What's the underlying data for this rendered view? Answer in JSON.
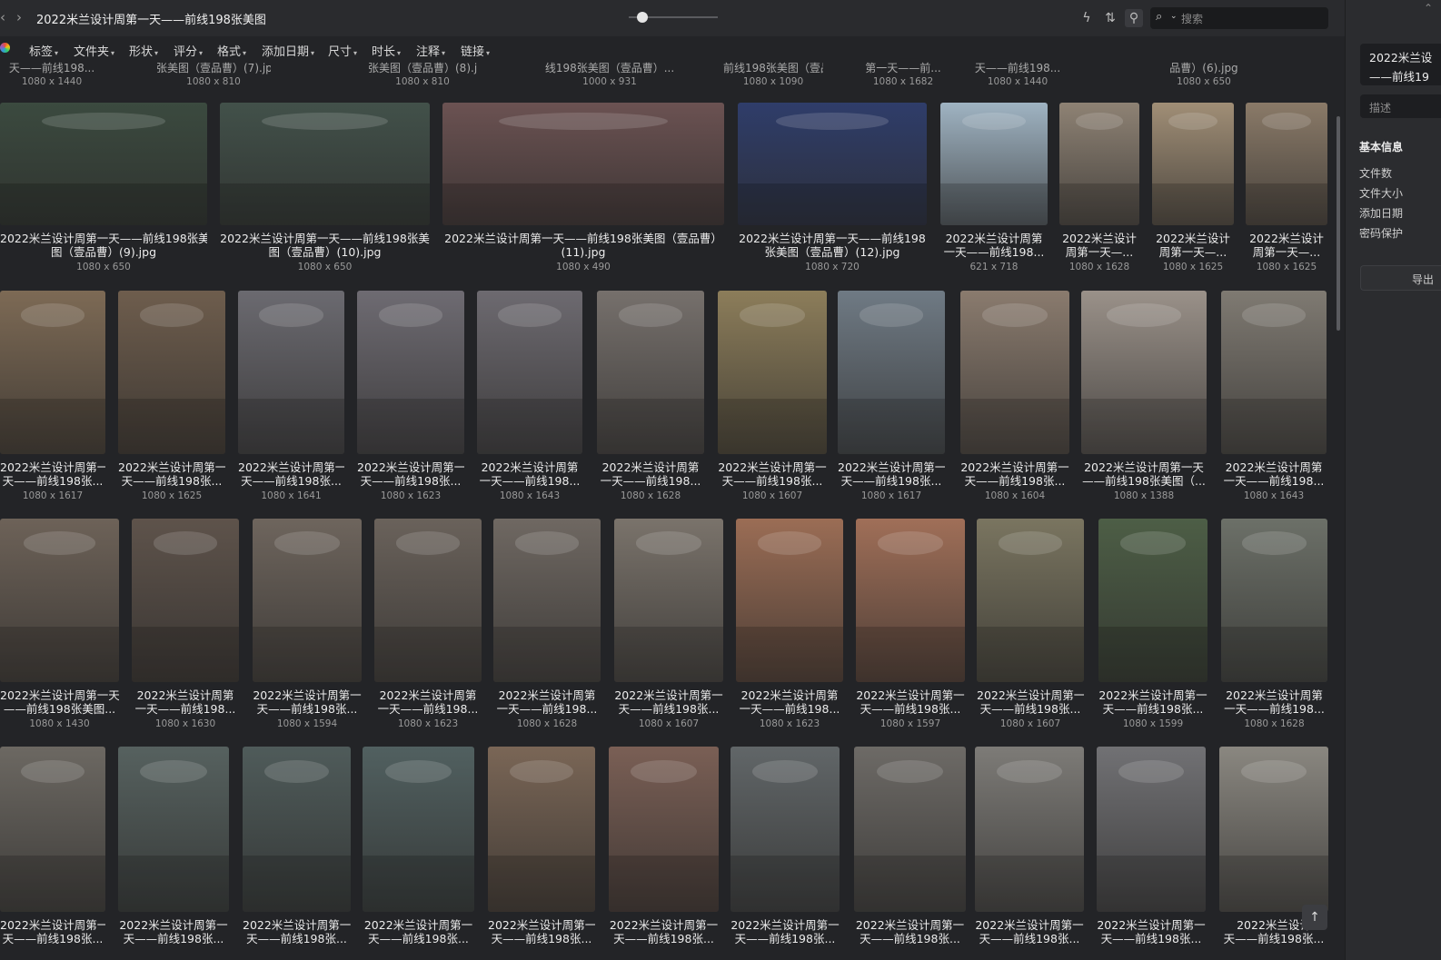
{
  "window": {
    "title": "2022米兰设计周第一天——前线198张美图"
  },
  "toolbar": {
    "back_icon": "‹",
    "forward_icon": "›",
    "search_placeholder": "搜索",
    "icons": {
      "lightning": "ϟ",
      "sort": "⇅",
      "filter": "⚲",
      "search": "⌕",
      "caret": "⌄"
    },
    "zoom_level": 0.1
  },
  "filters": [
    "标签",
    "文件夹",
    "形状",
    "评分",
    "格式",
    "添加日期",
    "尺寸",
    "时长",
    "注释",
    "链接"
  ],
  "previous_row": [
    {
      "name": "天——前线198...",
      "dim": "1080 x 1440"
    },
    {
      "name": "张美图（壹品曹）(7).jpg",
      "dim": "1080 x 810"
    },
    {
      "name": "张美图（壹品曹）(8).jpg",
      "dim": "1080 x 810"
    },
    {
      "name": "线198张美图（壹品曹）...",
      "dim": "1000 x 931"
    },
    {
      "name": "前线198张美图（壹品曹...",
      "dim": "1080 x 1090"
    },
    {
      "name": "第一天——前...",
      "dim": "1080 x 1682"
    },
    {
      "name": "天——前线198...",
      "dim": "1080 x 1440"
    },
    {
      "name": "品曹）(6).jpg",
      "dim": "1080 x 650"
    }
  ],
  "rows": [
    [
      {
        "name1": "2022米兰设计周第一天——前线198张美",
        "name2": "图（壹品曹）(9).jpg",
        "dim": "1080 x 650",
        "color": "#3b4a3f"
      },
      {
        "name1": "2022米兰设计周第一天——前线198张美",
        "name2": "图（壹品曹）(10).jpg",
        "dim": "1080 x 650",
        "color": "#42514a"
      },
      {
        "name1": "2022米兰设计周第一天——前线198张美图（壹品曹）",
        "name2": "(11).jpg",
        "dim": "1080 x 490",
        "color": "#6b5252"
      },
      {
        "name1": "2022米兰设计周第一天——前线198",
        "name2": "张美图（壹品曹）(12).jpg",
        "dim": "1080 x 720",
        "color": "#2f3d6a"
      },
      {
        "name1": "2022米兰设计周第",
        "name2": "一天——前线198...",
        "dim": "621 x 718",
        "color": "#9fb3c2"
      },
      {
        "name1": "2022米兰设计",
        "name2": "周第一天—...",
        "dim": "1080 x 1628",
        "color": "#8e8274"
      },
      {
        "name1": "2022米兰设计",
        "name2": "周第一天—...",
        "dim": "1080 x 1625",
        "color": "#a08e76"
      },
      {
        "name1": "2022米兰设计",
        "name2": "周第一天—...",
        "dim": "1080 x 1625",
        "color": "#8a7a68"
      }
    ],
    [
      {
        "name1": "2022米兰设计周第一",
        "name2": "天——前线198张...",
        "dim": "1080 x 1617",
        "color": "#7d6a55"
      },
      {
        "name1": "2022米兰设计周第一",
        "name2": "天——前线198张...",
        "dim": "1080 x 1625",
        "color": "#6e5d4d"
      },
      {
        "name1": "2022米兰设计周第一",
        "name2": "天——前线198张...",
        "dim": "1080 x 1641",
        "color": "#6b6a70"
      },
      {
        "name1": "2022米兰设计周第一",
        "name2": "天——前线198张...",
        "dim": "1080 x 1623",
        "color": "#6e6b72"
      },
      {
        "name1": "2022米兰设计周第",
        "name2": "一天——前线198...",
        "dim": "1080 x 1643",
        "color": "#6d6a70"
      },
      {
        "name1": "2022米兰设计周第",
        "name2": "一天——前线198...",
        "dim": "1080 x 1628",
        "color": "#76706c"
      },
      {
        "name1": "2022米兰设计周第一",
        "name2": "天——前线198张...",
        "dim": "1080 x 1607",
        "color": "#8c7d5a"
      },
      {
        "name1": "2022米兰设计周第一",
        "name2": "天——前线198张...",
        "dim": "1080 x 1617",
        "color": "#6f7a84"
      },
      {
        "name1": "2022米兰设计周第一",
        "name2": "天——前线198张...",
        "dim": "1080 x 1604",
        "color": "#8a7b6e"
      },
      {
        "name1": "2022米兰设计周第一天",
        "name2": "——前线198张美图（...",
        "dim": "1080 x 1388",
        "color": "#9a9189"
      },
      {
        "name1": "2022米兰设计周第",
        "name2": "一天——前线198...",
        "dim": "1080 x 1643",
        "color": "#7f7a72"
      }
    ],
    [
      {
        "name1": "2022米兰设计周第一天",
        "name2": "——前线198张美图...",
        "dim": "1080 x 1430",
        "color": "#6d6258"
      },
      {
        "name1": "2022米兰设计周第",
        "name2": "一天——前线198...",
        "dim": "1080 x 1630",
        "color": "#5e534b"
      },
      {
        "name1": "2022米兰设计周第一",
        "name2": "天——前线198张...",
        "dim": "1080 x 1594",
        "color": "#6e655d"
      },
      {
        "name1": "2022米兰设计周第",
        "name2": "一天——前线198...",
        "dim": "1080 x 1623",
        "color": "#6a625b"
      },
      {
        "name1": "2022米兰设计周第",
        "name2": "一天——前线198...",
        "dim": "1080 x 1628",
        "color": "#6f6862"
      },
      {
        "name1": "2022米兰设计周第一",
        "name2": "天——前线198张...",
        "dim": "1080 x 1607",
        "color": "#7a736b"
      },
      {
        "name1": "2022米兰设计周第",
        "name2": "一天——前线198...",
        "dim": "1080 x 1623",
        "color": "#9b6d55"
      },
      {
        "name1": "2022米兰设计周第一",
        "name2": "天——前线198张...",
        "dim": "1080 x 1597",
        "color": "#a06f58"
      },
      {
        "name1": "2022米兰设计周第一",
        "name2": "天——前线198张...",
        "dim": "1080 x 1607",
        "color": "#7a7560"
      },
      {
        "name1": "2022米兰设计周第一",
        "name2": "天——前线198张...",
        "dim": "1080 x 1599",
        "color": "#4d5e46"
      },
      {
        "name1": "2022米兰设计周第",
        "name2": "一天——前线198...",
        "dim": "1080 x 1628",
        "color": "#6c7068"
      }
    ],
    [
      {
        "name1": "2022米兰设计周第一",
        "name2": "天——前线198张...",
        "dim": "",
        "color": "#6c6862"
      },
      {
        "name1": "2022米兰设计周第一",
        "name2": "天——前线198张...",
        "dim": "",
        "color": "#56615f"
      },
      {
        "name1": "2022米兰设计周第一",
        "name2": "天——前线198张...",
        "dim": "",
        "color": "#4f5b5a"
      },
      {
        "name1": "2022米兰设计周第一",
        "name2": "天——前线198张...",
        "dim": "",
        "color": "#516060"
      },
      {
        "name1": "2022米兰设计周第一",
        "name2": "天——前线198张...",
        "dim": "",
        "color": "#7a6656"
      },
      {
        "name1": "2022米兰设计周第一",
        "name2": "天——前线198张...",
        "dim": "",
        "color": "#7a5f55"
      },
      {
        "name1": "2022米兰设计周第一",
        "name2": "天——前线198张...",
        "dim": "",
        "color": "#616668"
      },
      {
        "name1": "2022米兰设计周第一",
        "name2": "天——前线198张...",
        "dim": "",
        "color": "#6d6a66"
      },
      {
        "name1": "2022米兰设计周第一",
        "name2": "天——前线198张...",
        "dim": "",
        "color": "#7d7b77"
      },
      {
        "name1": "2022米兰设计周第一",
        "name2": "天——前线198张...",
        "dim": "",
        "color": "#717174"
      },
      {
        "name1": "2022米兰设计",
        "name2": "天——前线198张...",
        "dim": "",
        "color": "#8a8780"
      }
    ]
  ],
  "sidebar": {
    "close_icon": "⌃",
    "title_line1": "2022米兰设",
    "title_line2": "——前线19",
    "description_placeholder": "描述",
    "section_basic": "基本信息",
    "labels": [
      "文件数",
      "文件大小",
      "添加日期",
      "密码保护"
    ],
    "export_label": "导出"
  },
  "back_to_top_icon": "↑"
}
